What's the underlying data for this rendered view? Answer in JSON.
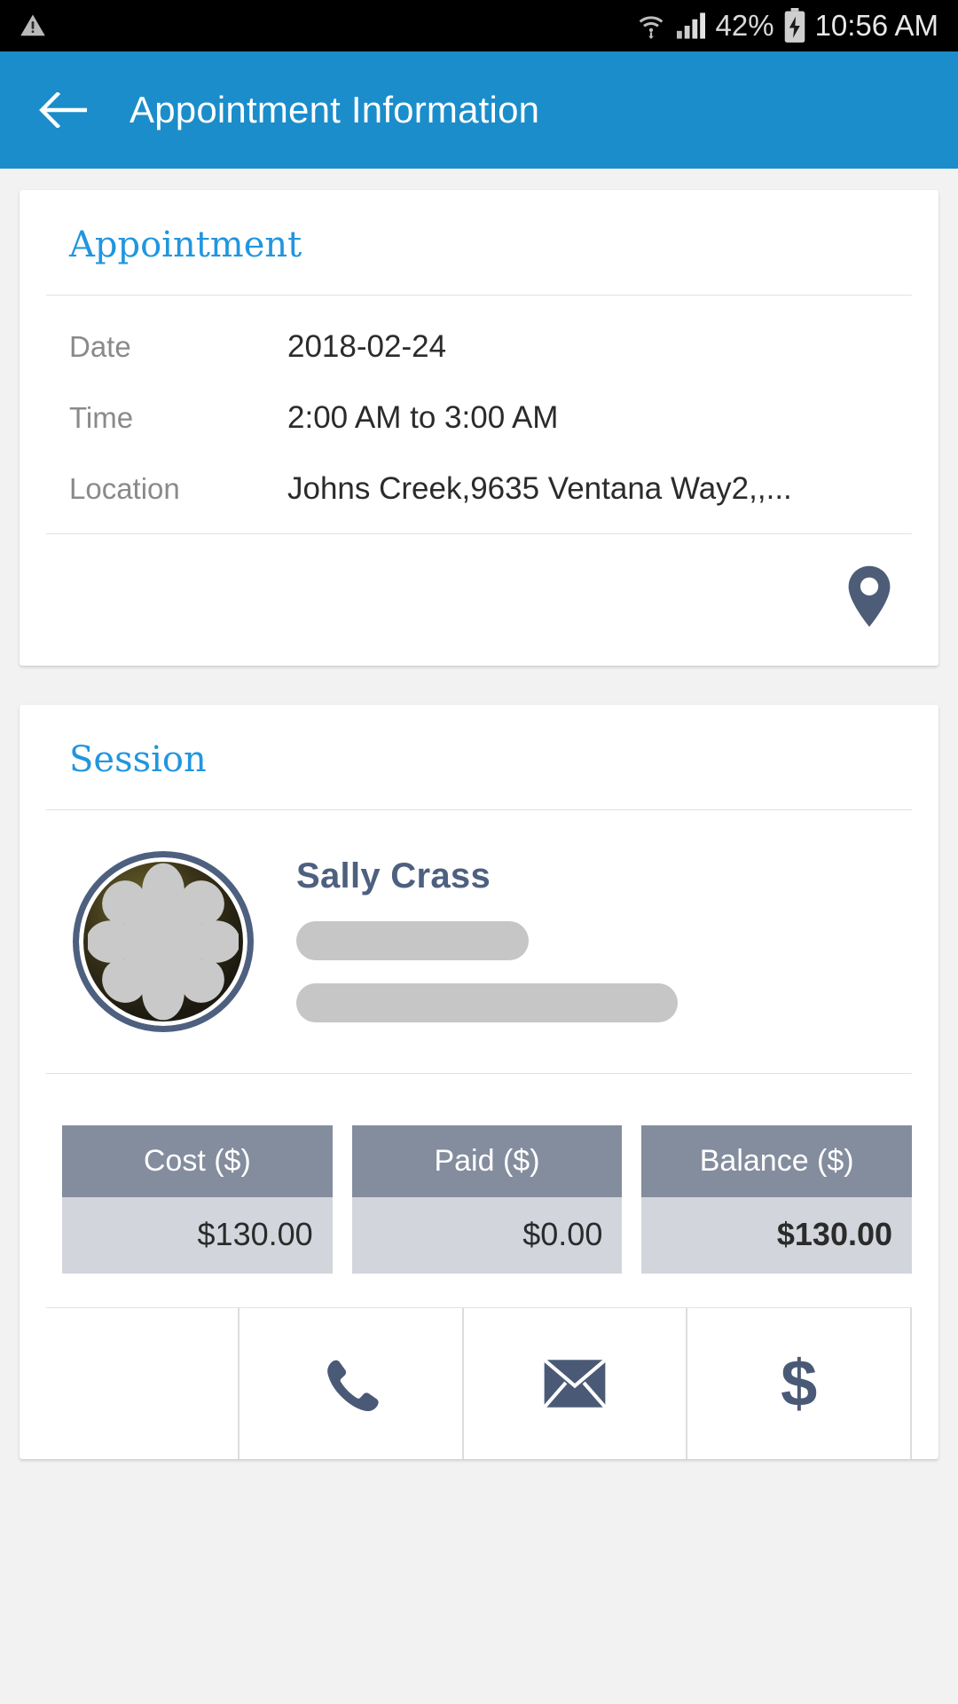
{
  "statusbar": {
    "warning_icon": "warning-triangle-icon",
    "wifi_icon": "wifi-icon",
    "signal_icon": "cellular-signal-icon",
    "battery_percent": "42%",
    "battery_icon": "battery-charging-icon",
    "time": "10:56 AM"
  },
  "appbar": {
    "back_icon": "back-arrow-icon",
    "title": "Appointment Information",
    "background": "#1b8dcb"
  },
  "appointment_card": {
    "title": "Appointment",
    "title_color": "#2196de",
    "rows": [
      {
        "label": "Date",
        "value": "2018-02-24"
      },
      {
        "label": "Time",
        "value": "2:00 AM to 3:00 AM"
      },
      {
        "label": "Location",
        "value": "Johns Creek,9635 Ventana Way2,,..."
      }
    ],
    "map_pin_icon": "map-pin-icon"
  },
  "session_card": {
    "title": "Session",
    "title_color": "#2196de",
    "person": {
      "avatar_icon": "avatar-photo",
      "name": "Sally Crass",
      "name_color": "#4e6080",
      "redacted_line_1": "",
      "redacted_line_2": ""
    },
    "money": {
      "headers": [
        "Cost ($)",
        "Paid ($)",
        "Balance ($)"
      ],
      "values": [
        "$130.00",
        "$0.00",
        "$130.00"
      ],
      "header_bg": "#848d9e",
      "cell_bg": "#d2d6dc"
    },
    "actions": [
      {
        "name": "call-button",
        "icon": "phone-icon",
        "label": ""
      },
      {
        "name": "email-button",
        "icon": "envelope-icon",
        "label": ""
      },
      {
        "name": "payment-button",
        "icon": "dollar-icon",
        "label": "$"
      }
    ]
  }
}
